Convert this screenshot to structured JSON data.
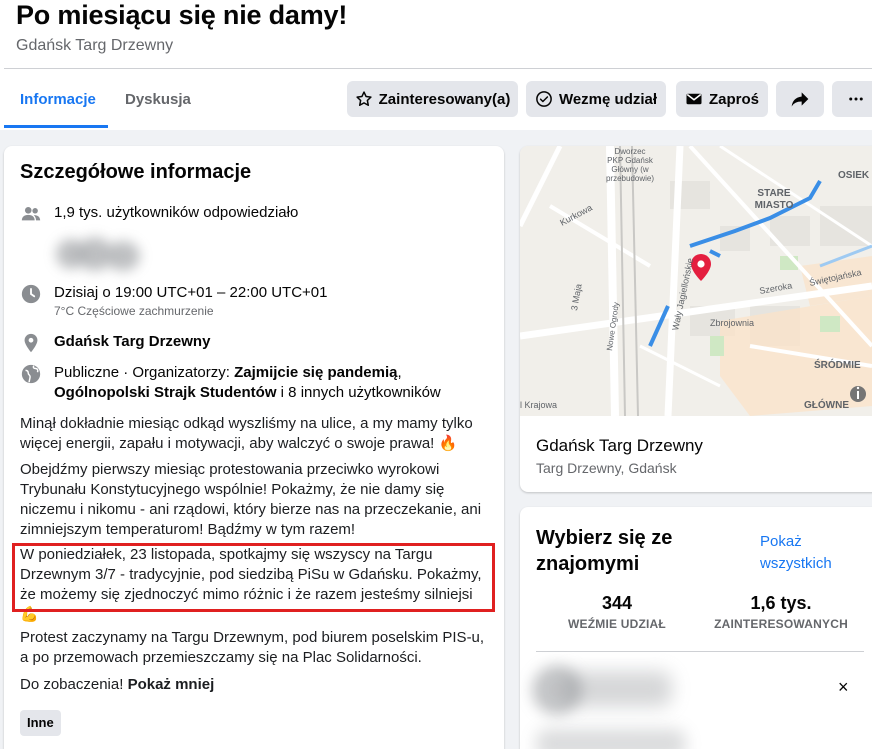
{
  "event": {
    "title": "Po miesiącu się nie damy!",
    "location_sub": "Gdańsk Targ Drzewny"
  },
  "tabs": [
    {
      "label": "Informacje",
      "active": true
    },
    {
      "label": "Dyskusja",
      "active": false
    }
  ],
  "actions": {
    "interested": "Zainteresowany(a)",
    "going": "Wezmę udział",
    "invite": "Zaproś"
  },
  "details": {
    "heading": "Szczegółowe informacje",
    "responded": "1,9 tys. użytkowników odpowiedziało",
    "time": "Dzisiaj o 19:00 UTC+01 – 22:00 UTC+01",
    "weather": "7°C Częściowe zachmurzenie",
    "place": "Gdańsk Targ Drzewny",
    "org_prefix": "Publiczne · Organizatorzy: ",
    "org1": "Zajmijcie się pandemią",
    "org_sep": ", ",
    "org2": "Ogólnopolski Strajk Studentów",
    "org_suffix": " i 8 innych użytkowników",
    "para1": "Minął dokładnie miesiąc odkąd wyszliśmy na ulice, a my mamy tylko więcej energii, zapału i motywacji, aby walczyć o swoje prawa! 🔥",
    "para2": "Obejdźmy pierwszy miesiąc protestowania przeciwko wyrokowi Trybunału Konstytucyjnego wspólnie! Pokażmy, że nie damy się niczemu i nikomu - ani rządowi, który bierze nas na przeczekanie, ani zimniejszym temperaturom! Bądźmy w tym razem!",
    "para3": "W poniedziałek, 23 listopada, spotkajmy się wszyscy na Targu Drzewnym 3/7 - tradycyjnie, pod siedzibą PiSu w Gdańsku. Pokażmy, że możemy się zjednoczyć mimo różnic i że razem jesteśmy silniejsi 💪",
    "para4": "Protest zaczynamy na Targu Drzewnym, pod biurem poselskim PIS-u, a po przemowach przemieszczamy się na Plac Solidarności.",
    "para5_prefix": "Do zobaczenia! ",
    "show_less": "Pokaż mniej",
    "tag": "Inne"
  },
  "map": {
    "labels": {
      "dworzec": [
        "Dworzec",
        "PKP Gdańsk",
        "Główny (w",
        "przebudowie)"
      ],
      "stare": [
        "STARE",
        "MIASTO"
      ],
      "osiek": "OSIEK",
      "kurkowa": "Kurkowa",
      "majal": "3 Maja",
      "nowogrodzka": "Nowe Ogrody",
      "jagiellon": "Wały Jagiellońskie",
      "szeroka": "Szeroka",
      "swieto": "Świętojańska",
      "zbrojownia": "Zbrojownia",
      "srodmiescie": "ŚRÓDMIE",
      "glowne": "GŁÓWNE",
      "krajowa": "l Krajowa"
    },
    "place_name": "Gdańsk Targ Drzewny",
    "place_sub": "Targ Drzewny, Gdańsk"
  },
  "friends": {
    "heading": "Wybierz się ze znajomymi",
    "see_all": "Pokaż wszystkich",
    "going_count": "344",
    "going_label": "WEŹMIE UDZIAŁ",
    "interested_count": "1,6 tys.",
    "interested_label": "ZAINTERESOWANYCH"
  },
  "colors": {
    "accent": "#1877f2",
    "highlight_box": "#e02020",
    "pin": "#e41e3f"
  }
}
